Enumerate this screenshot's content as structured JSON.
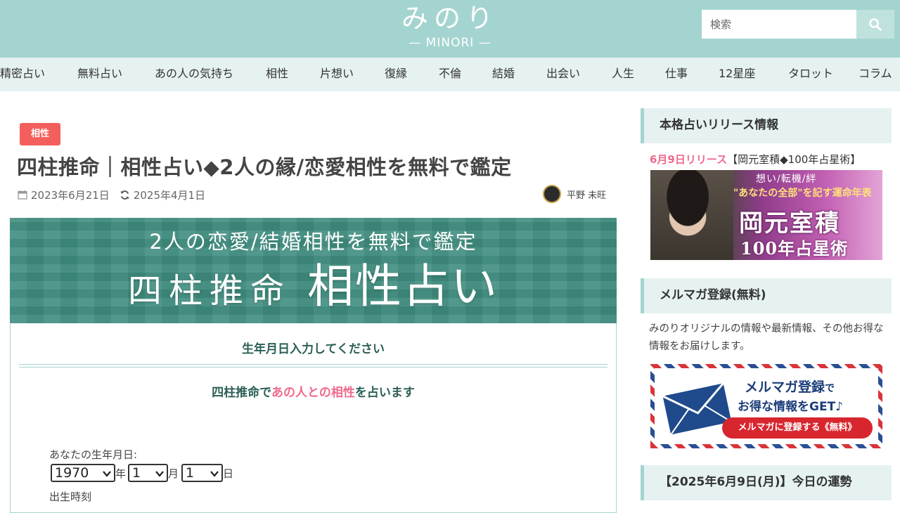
{
  "header": {
    "logo_main": "みのり",
    "logo_sub": "— MINORI —",
    "search_placeholder": "検索"
  },
  "nav": {
    "items": [
      "精密占い",
      "無料占い",
      "あの人の気持ち",
      "相性",
      "片想い",
      "復縁",
      "不倫",
      "結婚",
      "出会い",
      "人生",
      "仕事",
      "12星座",
      "タロット",
      "コラム"
    ]
  },
  "article": {
    "category": "相性",
    "title": "四柱推命｜相性占い◆2人の縁/恋愛相性を無料で鑑定",
    "published": "2023年6月21日",
    "updated": "2025年4月1日",
    "author": "平野 未旺"
  },
  "hero": {
    "subtitle": "2人の恋愛/結婚相性を無料で鑑定",
    "title_small": "四柱推命",
    "title_large": "相性占い"
  },
  "form": {
    "heading": "生年月日入力してください",
    "lead_prefix": "四柱推命で",
    "lead_highlight": "あの人との相性",
    "lead_suffix": "を占います",
    "birth_label": "あなたの生年月日:",
    "year_value": "1970",
    "month_value": "1",
    "day_value": "1",
    "year_unit": "年",
    "month_unit": "月",
    "day_unit": "日",
    "time_label": "出生時刻"
  },
  "sidebar": {
    "release_heading": "本格占いリリース情報",
    "release_date": "6月9日リリース",
    "release_title": "【岡元室積◆100年占星術】",
    "release_banner": {
      "line1": "想い/転機/絆",
      "line2": "\"あなたの全部\"を記す運命年表",
      "line3": "岡元室積",
      "line4": "100年占星術"
    },
    "mail_heading": "メルマガ登録(無料)",
    "mail_desc": "みのりオリジナルの情報や最新情報、その他お得な情報をお届けします。",
    "mail_banner": {
      "line1": "メルマガ登録",
      "line1_suffix": "で",
      "line2": "お得な情報をGET♪",
      "button": "メルマガに登録する《無料》"
    },
    "fortune_heading": "【2025年6月9日(月)】今日の運勢"
  },
  "colors": {
    "header_bg": "#a4d4cf",
    "nav_bg": "#e6f2f1",
    "badge": "#f25f5c",
    "hero_bg": "#3e8c7e",
    "accent_pink": "#ef6a8d"
  }
}
